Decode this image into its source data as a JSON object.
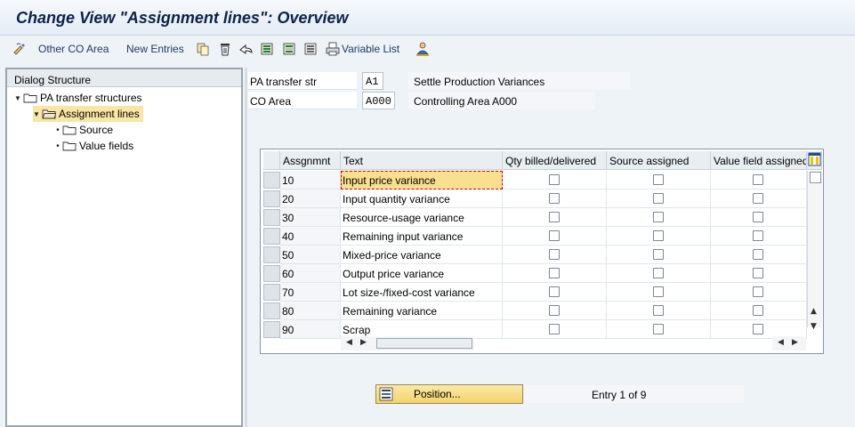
{
  "window": {
    "title": "Change View \"Assignment lines\": Overview"
  },
  "toolbar": {
    "other_co_area_label": "Other CO Area",
    "new_entries_label": "New Entries",
    "variable_list_label": "Variable List",
    "icons": [
      "edit-pencil-icon",
      "copy-icon",
      "delete-icon",
      "undo-icon",
      "select-all-icon",
      "select-block-icon",
      "deselect-icon",
      "print-icon",
      "person-icon"
    ]
  },
  "dialog_structure": {
    "header": "Dialog Structure",
    "items": [
      {
        "label": "PA transfer structures",
        "level": 0,
        "expanded": true
      },
      {
        "label": "Assignment lines",
        "level": 1,
        "expanded": true,
        "selected": true
      },
      {
        "label": "Source",
        "level": 2
      },
      {
        "label": "Value fields",
        "level": 2
      }
    ]
  },
  "header_fields": {
    "pa_transfer_str": {
      "label": "PA transfer str",
      "value": "A1",
      "description": "Settle Production Variances"
    },
    "co_area": {
      "label": "CO Area",
      "value": "A000",
      "description": "Controlling Area A000"
    }
  },
  "table": {
    "columns": [
      "Assgnmnt",
      "Text",
      "Qty billed/delivered",
      "Source assigned",
      "Value field assigned"
    ],
    "rows": [
      {
        "assignment": "10",
        "text": "Input price variance",
        "qty_billed": false,
        "source_assigned": false,
        "value_field_assigned": false
      },
      {
        "assignment": "20",
        "text": "Input quantity variance",
        "qty_billed": false,
        "source_assigned": false,
        "value_field_assigned": false
      },
      {
        "assignment": "30",
        "text": "Resource-usage variance",
        "qty_billed": false,
        "source_assigned": false,
        "value_field_assigned": false
      },
      {
        "assignment": "40",
        "text": "Remaining input variance",
        "qty_billed": false,
        "source_assigned": false,
        "value_field_assigned": false
      },
      {
        "assignment": "50",
        "text": "Mixed-price variance",
        "qty_billed": false,
        "source_assigned": false,
        "value_field_assigned": false
      },
      {
        "assignment": "60",
        "text": "Output price variance",
        "qty_billed": false,
        "source_assigned": false,
        "value_field_assigned": false
      },
      {
        "assignment": "70",
        "text": "Lot size-/fixed-cost variance",
        "qty_billed": false,
        "source_assigned": false,
        "value_field_assigned": false
      },
      {
        "assignment": "80",
        "text": "Remaining variance",
        "qty_billed": false,
        "source_assigned": false,
        "value_field_assigned": false
      },
      {
        "assignment": "90",
        "text": "Scrap",
        "qty_billed": false,
        "source_assigned": false,
        "value_field_assigned": false
      }
    ]
  },
  "footer": {
    "position_button_label": "Position...",
    "entry_text": "Entry 1 of 9"
  },
  "colors": {
    "selected_row": "#f9e6a4",
    "active_cell": "#f8e08f",
    "title_text": "#0c2248",
    "toolbar_text": "#1d3a63"
  }
}
